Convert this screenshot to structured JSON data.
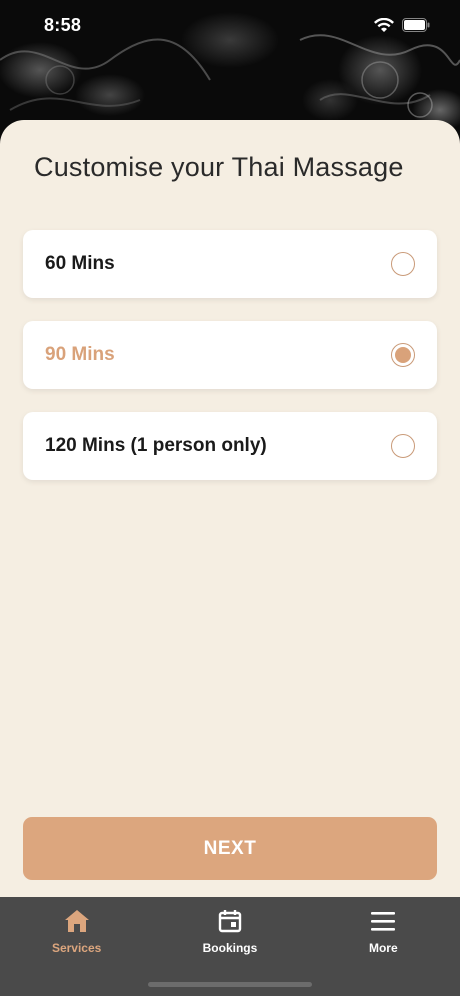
{
  "status_bar": {
    "time": "8:58"
  },
  "page": {
    "title": "Customise your Thai Massage"
  },
  "options": [
    {
      "label": "60 Mins",
      "selected": false
    },
    {
      "label": "90 Mins",
      "selected": true
    },
    {
      "label": "120 Mins (1 person only)",
      "selected": false
    }
  ],
  "actions": {
    "next_label": "NEXT"
  },
  "tabs": [
    {
      "label": "Services",
      "icon": "home-icon",
      "active": true
    },
    {
      "label": "Bookings",
      "icon": "calendar-icon",
      "active": false
    },
    {
      "label": "More",
      "icon": "menu-icon",
      "active": false
    }
  ],
  "colors": {
    "accent": "#dca67e",
    "sheet_bg": "#f5eee2",
    "tab_bar_bg": "#4a4a4a"
  }
}
